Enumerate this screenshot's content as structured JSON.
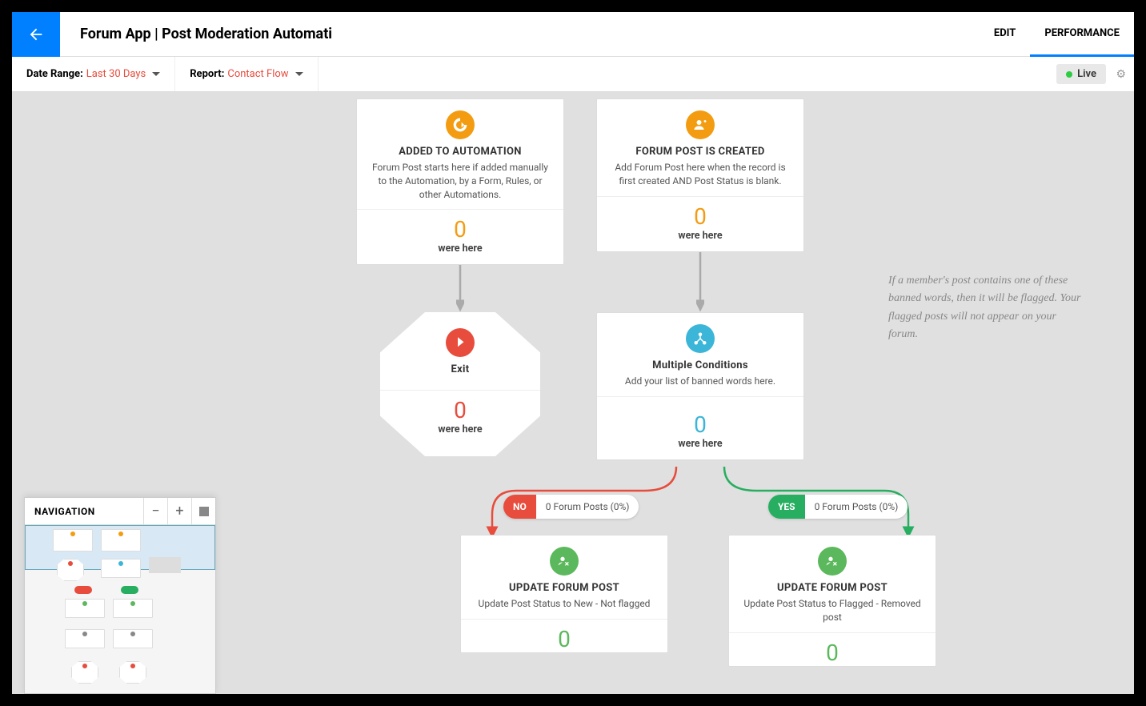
{
  "header": {
    "title": "Forum App | Post Moderation Automati",
    "tabs": {
      "edit": "EDIT",
      "performance": "PERFORMANCE"
    }
  },
  "subheader": {
    "dateRange": {
      "label": "Date Range:",
      "value": "Last 30 Days"
    },
    "report": {
      "label": "Report:",
      "value": "Contact Flow"
    },
    "liveStatus": "Live"
  },
  "nodes": {
    "addedToAutomation": {
      "title": "ADDED TO AUTOMATION",
      "desc": "Forum Post starts here if added manually to the Automation, by a Form, Rules, or other Automations.",
      "count": "0",
      "label": "were here"
    },
    "forumPostCreated": {
      "title": "FORUM POST IS CREATED",
      "desc": "Add Forum Post here when the record is first created AND Post Status is blank.",
      "count": "0",
      "label": "were here"
    },
    "exit": {
      "title": "Exit",
      "count": "0",
      "label": "were here"
    },
    "multipleConditions": {
      "title": "Multiple Conditions",
      "desc": "Add your list of banned words here.",
      "count": "0",
      "label": "were here"
    },
    "updateNo": {
      "title": "UPDATE FORUM POST",
      "desc": "Update Post Status to New - Not flagged",
      "count": "0"
    },
    "updateYes": {
      "title": "UPDATE FORUM POST",
      "desc": "Update Post Status to Flagged - Removed post",
      "count": "0"
    }
  },
  "branches": {
    "no": {
      "badge": "NO",
      "text": "0 Forum Posts (0%)"
    },
    "yes": {
      "badge": "YES",
      "text": "0 Forum Posts (0%)"
    }
  },
  "annotation": "If a member's post contains one of these banned words, then it will be flagged. Your flagged posts will not appear on your forum.",
  "navigator": {
    "title": "NAVIGATION"
  }
}
